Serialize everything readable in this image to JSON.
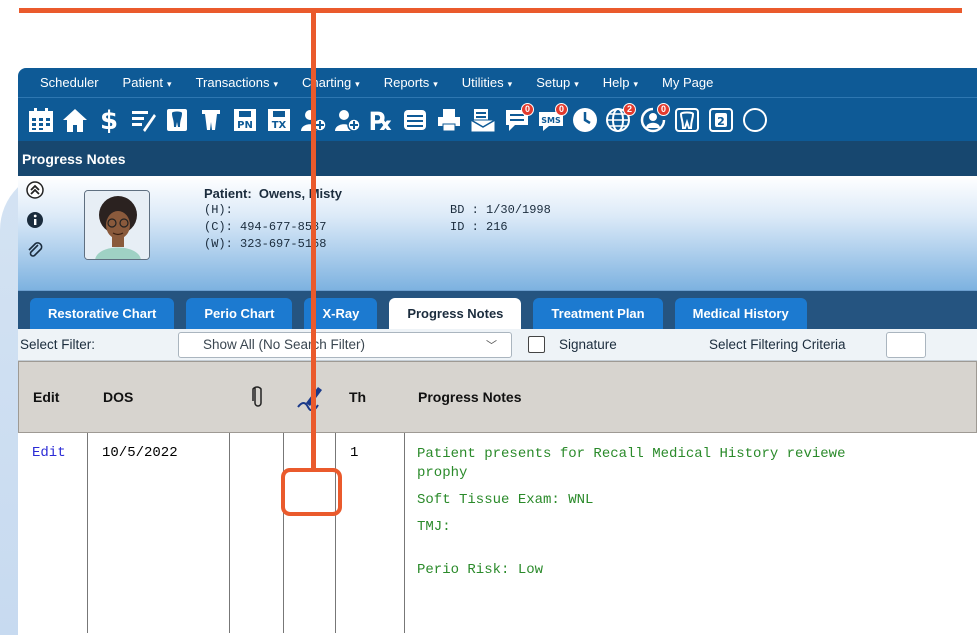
{
  "menu": [
    {
      "label": "Scheduler",
      "caret": false
    },
    {
      "label": "Patient",
      "caret": true
    },
    {
      "label": "Transactions",
      "caret": true
    },
    {
      "label": "Charting",
      "caret": true
    },
    {
      "label": "Reports",
      "caret": true
    },
    {
      "label": "Utilities",
      "caret": true
    },
    {
      "label": "Setup",
      "caret": true
    },
    {
      "label": "Help",
      "caret": true
    },
    {
      "label": "My Page",
      "caret": false
    }
  ],
  "toolbar": {
    "icons": [
      "calendar-icon",
      "home-icon",
      "dollar-icon",
      "chart-pen-icon",
      "tooth-icon",
      "tooth-alt-icon",
      "tooth-pn-icon",
      "tooth-tx-icon",
      "user-add-icon",
      "user-plus-icon",
      "rx-icon",
      "list-icon",
      "printer-icon",
      "envelope-list-icon",
      "chat-icon",
      "sms-icon",
      "clock-icon",
      "globe-icon",
      "refresh-user-icon",
      "tooth-outline-icon",
      "tooth-number-icon"
    ],
    "pn_label": "PN",
    "tx_label": "TX",
    "sms_label": "SMS",
    "badge_chat": "0",
    "badge_sms": "0",
    "badge_globe": "2",
    "badge_refresh": "0",
    "tooth_number": "2"
  },
  "section_title": "Progress Notes",
  "patient": {
    "name_label": "Patient:",
    "name": "Owens, Misty",
    "home_label": "(H):",
    "home": "",
    "cell_label": "(C):",
    "cell": "494-677-8587",
    "work_label": "(W):",
    "work": "323-697-5158",
    "bd_label": "BD :",
    "bd": "1/30/1998",
    "id_label": "ID :",
    "id": "216"
  },
  "tabs": [
    "Restorative Chart",
    "Perio Chart",
    "X-Ray",
    "Progress Notes",
    "Treatment Plan",
    "Medical History"
  ],
  "active_tab": "Progress Notes",
  "filter": {
    "label": "Select Filter:",
    "selected": "Show All (No Search Filter)",
    "signature_label": "Signature",
    "criteria_label": "Select Filtering Criteria"
  },
  "table": {
    "headers": {
      "edit": "Edit",
      "dos": "DOS",
      "th": "Th",
      "notes": "Progress Notes"
    },
    "row": {
      "edit": "Edit",
      "dos": "10/5/2022",
      "th": "1",
      "notes": [
        "Patient presents for Recall  Medical History reviewe",
        "prophy",
        "Soft Tissue Exam: WNL",
        "TMJ:",
        "",
        "Perio Risk: Low"
      ]
    }
  },
  "colors": {
    "menu_bg": "#0e5a96",
    "annotation": "#ea5a2c",
    "notes_text": "#2a8a2a"
  }
}
